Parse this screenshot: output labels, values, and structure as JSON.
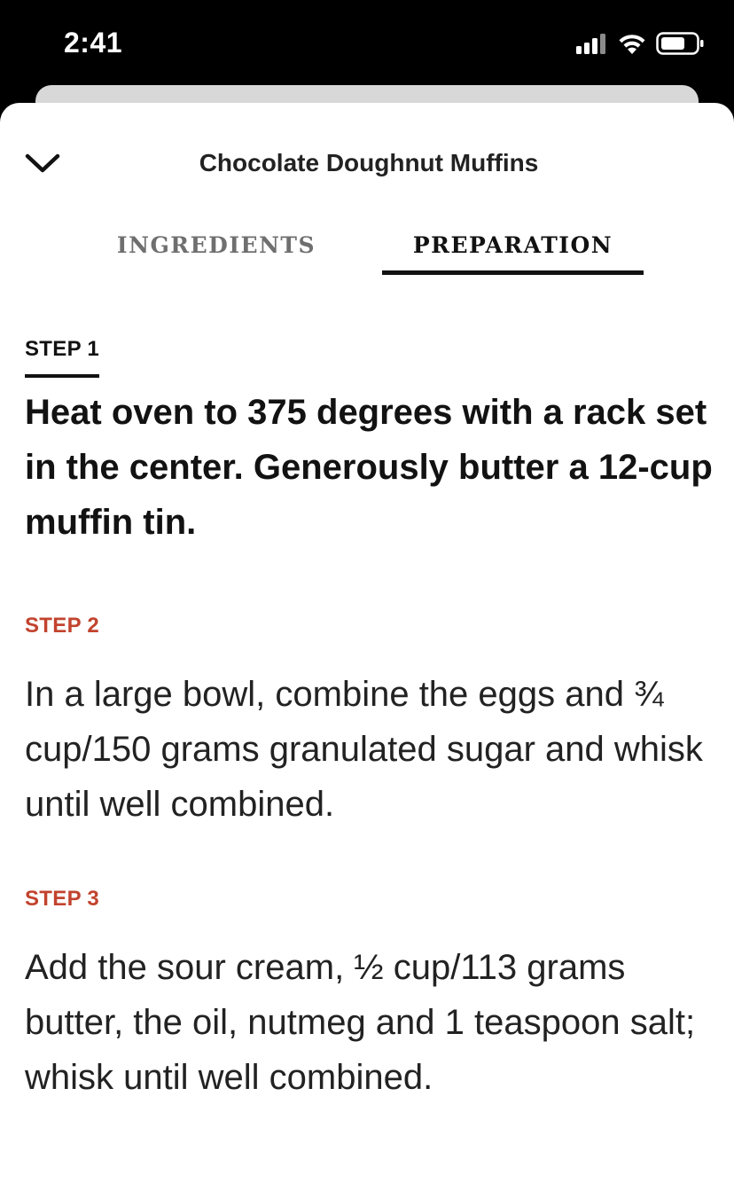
{
  "status_bar": {
    "time": "2:41",
    "icons": [
      "cellular-signal-icon",
      "wifi-icon",
      "battery-icon"
    ]
  },
  "header": {
    "title": "Chocolate Doughnut Muffins",
    "collapse_icon": "chevron-down-icon"
  },
  "tabs": [
    {
      "label": "INGREDIENTS",
      "active": false
    },
    {
      "label": "PREPARATION",
      "active": true
    }
  ],
  "steps": [
    {
      "label": "STEP 1",
      "text": "Heat oven to 375 degrees with a rack set in the center. Generously butter a 12-cup muffin tin.",
      "active": true
    },
    {
      "label": "STEP 2",
      "text": "In a large bowl, combine the eggs and ¾ cup/150 grams granulated sugar and whisk until well combined.",
      "active": false
    },
    {
      "label": "STEP 3",
      "text": "Add the sour cream, ½ cup/113 grams butter, the oil, nutmeg and 1 teaspoon salt; whisk until well combined.",
      "active": false
    }
  ],
  "colors": {
    "accent_step_label": "#c2432e",
    "active_text": "#121212",
    "inactive_tab": "#6f6f6f"
  }
}
